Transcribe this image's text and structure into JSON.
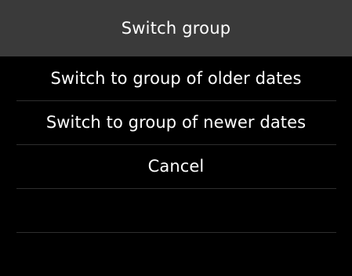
{
  "dialog": {
    "title": "Switch group"
  },
  "menu": {
    "items": [
      {
        "label": "Switch to group of older dates"
      },
      {
        "label": "Switch to group of newer dates"
      },
      {
        "label": "Cancel"
      },
      {
        "label": ""
      },
      {
        "label": ""
      }
    ]
  },
  "colors": {
    "header_background": "#3a3a3a",
    "screen_background": "#000000",
    "text": "#ffffff",
    "separator": "#2e2e2e"
  }
}
